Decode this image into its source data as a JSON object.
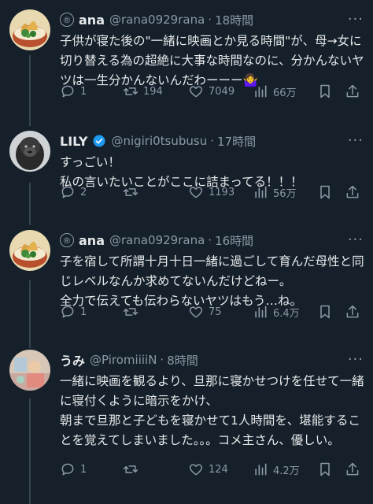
{
  "tweets": [
    {
      "name": "ana",
      "handle": "@rana0929rana",
      "time": "18時間",
      "text": "子供が寝た後の\"一緒に映画とか見る時間\"が、母→女に切り替える為の超絶に大事な時間なのに、分かんないヤツは一生分かんないんだわーーー🤷‍♀️",
      "replies": "1",
      "retweets": "194",
      "likes": "7049",
      "views": "66万",
      "avatar": "tempura-bowl"
    },
    {
      "name": "LILY",
      "handle": "@nigiri0tsubusu",
      "time": "17時間",
      "text": "すっごい！\n私の言いたいことがここに詰まってる！！！",
      "replies": "2",
      "retweets": "",
      "likes": "1193",
      "views": "56万",
      "avatar": "gorilla"
    },
    {
      "name": "ana",
      "handle": "@rana0929rana",
      "time": "16時間",
      "text": "子を宿して所謂十月十日一緒に過ごして育んだ母性と同じレベルなんか求めてないんだけどねー。\n全力で伝えても伝わらないヤツはもう…ね。",
      "replies": "1",
      "retweets": "",
      "likes": "75",
      "views": "6.4万",
      "avatar": "tempura-bowl"
    },
    {
      "name": "うみ",
      "handle": "@PiromiiiiN",
      "time": "8時間",
      "text": "一緒に映画を観るより、旦那に寝かせつけを任せて一緒に寝付くように暗示をかけ、\n朝まで旦那と子どもを寝かせて1人時間を、堪能することを覚えてしまいました。。。コメ主さん、優しい。",
      "replies": "1",
      "retweets": "",
      "likes": "124",
      "views": "4.2万",
      "avatar": "photo"
    }
  ],
  "more_label": "···"
}
